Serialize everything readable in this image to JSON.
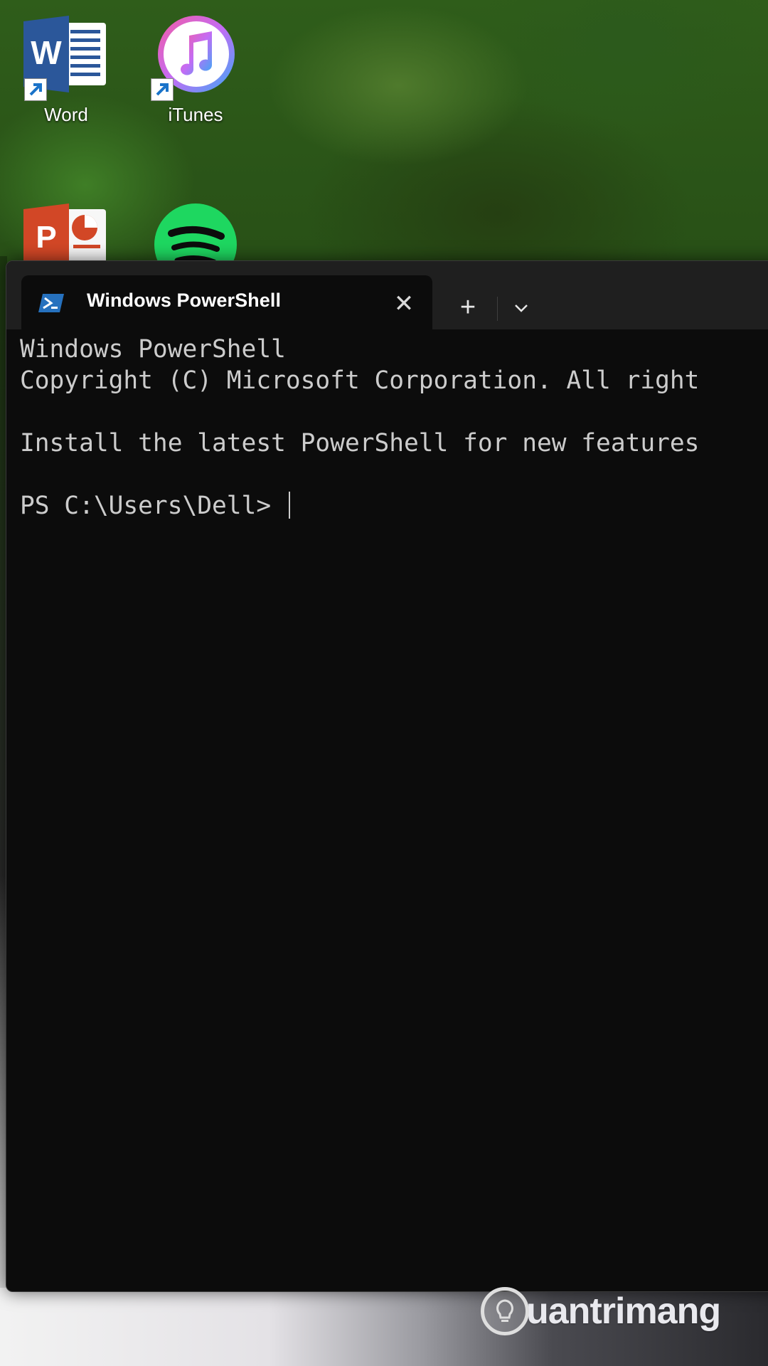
{
  "desktop": {
    "icons": [
      {
        "label": "Word",
        "icon": "word-icon"
      },
      {
        "label": "iTunes",
        "icon": "itunes-icon"
      },
      {
        "label": "",
        "icon": "powerpoint-icon"
      },
      {
        "label": "",
        "icon": "spotify-icon"
      }
    ]
  },
  "window": {
    "tab": {
      "title": "Windows PowerShell",
      "icon": "powershell-icon",
      "close_symbol": "✕"
    },
    "new_tab_symbol": "+",
    "dropdown_icon": "chevron-down-icon"
  },
  "terminal": {
    "lines": [
      "Windows PowerShell",
      "Copyright (C) Microsoft Corporation. All right",
      "Install the latest PowerShell for new features"
    ],
    "prompt": "PS C:\\Users\\Dell> "
  },
  "watermark": {
    "text": "uantrimang"
  },
  "colors": {
    "terminal_bg": "#0c0c0c",
    "titlebar_bg": "#1f1f1f",
    "terminal_text": "#cccccc",
    "spotify_green": "#1ed760",
    "word_blue": "#2b579a",
    "ppt_red": "#d24726"
  }
}
